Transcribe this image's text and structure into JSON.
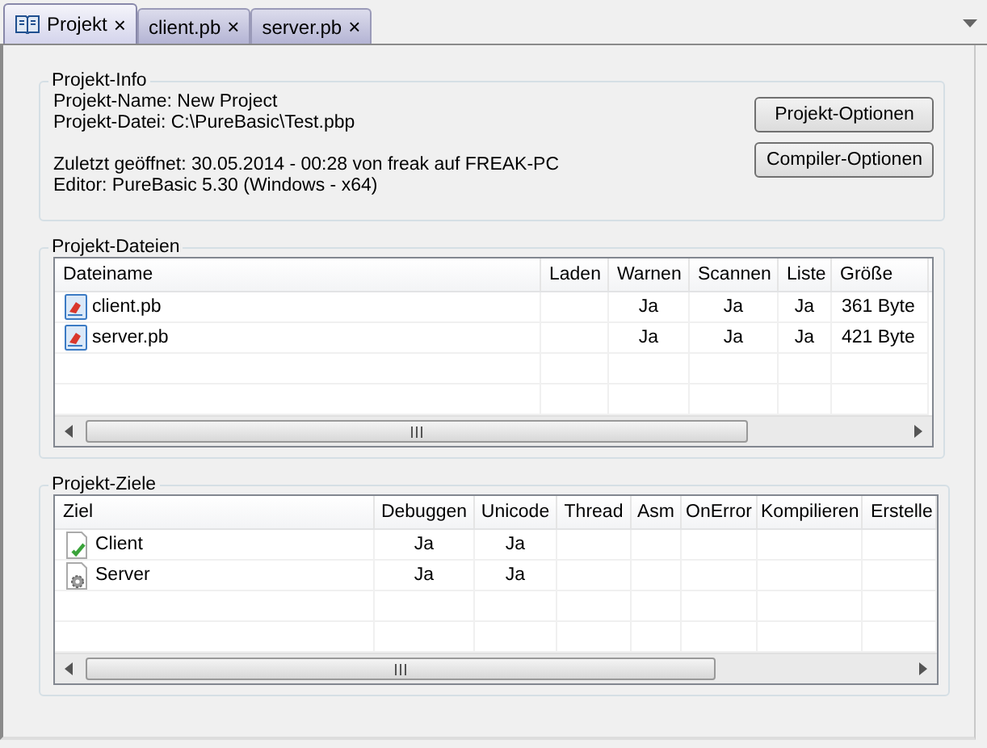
{
  "tabs": [
    {
      "label": "Projekt",
      "kind": "project",
      "selected": true,
      "close": "×"
    },
    {
      "label": "client.pb",
      "kind": "file",
      "selected": false,
      "close": "×"
    },
    {
      "label": "server.pb",
      "kind": "file",
      "selected": false,
      "close": "×"
    }
  ],
  "info": {
    "title": "Projekt-Info",
    "lines": [
      "Projekt-Name: New Project",
      "Projekt-Datei: C:\\PureBasic\\Test.pbp"
    ],
    "details": [
      "Zuletzt geöffnet: 30.05.2014 - 00:28 von freak auf FREAK-PC",
      "Editor: PureBasic 5.30 (Windows - x64)"
    ],
    "buttons": [
      "Projekt-Optionen",
      "Compiler-Optionen"
    ]
  },
  "files": {
    "title": "Projekt-Dateien",
    "columns": [
      "Dateiname",
      "Laden",
      "Warnen",
      "Scannen",
      "Liste",
      "Größe"
    ],
    "rows": [
      {
        "cells": [
          "client.pb",
          "",
          "Ja",
          "Ja",
          "Ja",
          "361 Byte"
        ]
      },
      {
        "cells": [
          "server.pb",
          "",
          "Ja",
          "Ja",
          "Ja",
          "421 Byte"
        ]
      }
    ]
  },
  "targets": {
    "title": "Projekt-Ziele",
    "columns": [
      "Ziel",
      "Debuggen",
      "Unicode",
      "Thread",
      "Asm",
      "OnError",
      "Kompilieren",
      "Erstelle"
    ],
    "rows": [
      {
        "kind": "check",
        "cells": [
          "Client",
          "Ja",
          "Ja",
          "",
          "",
          "",
          "",
          ""
        ]
      },
      {
        "kind": "gear",
        "cells": [
          "Server",
          "Ja",
          "Ja",
          "",
          "",
          "",
          "",
          ""
        ]
      }
    ]
  }
}
